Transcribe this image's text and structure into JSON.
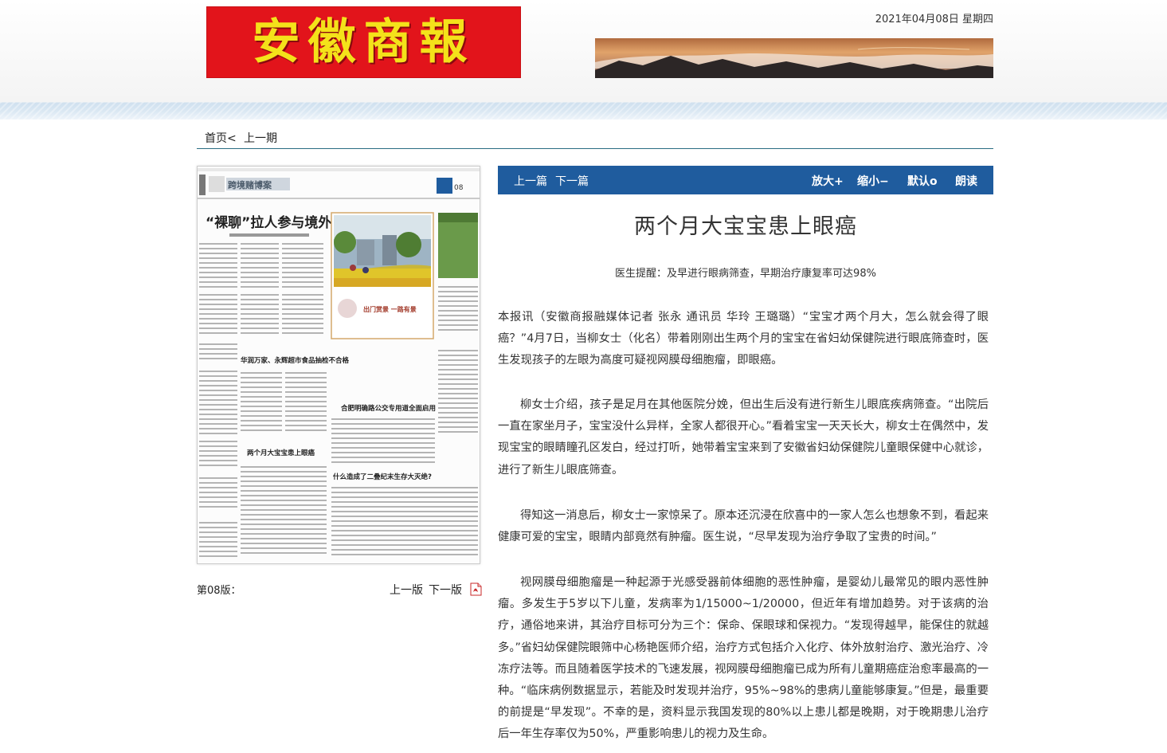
{
  "masthead": {
    "logo_text": "安徽商報",
    "date": "2021年04月08日 星期四"
  },
  "nav": {
    "home": "首页<",
    "prev_issue": "上一期"
  },
  "page_panel": {
    "edition_label": "第08版：",
    "prev_page": "上一版",
    "next_page": "下一版",
    "thumbnail": {
      "section_name": "跨境赌博案",
      "page_number": "08",
      "headlines": [
        "“裸聊”拉人参与境外网络赌博",
        "华润万家、永辉超市食品抽检不合格",
        "出门赏景 一路有景",
        "合肥明确路公交专用道全面启用",
        "两个月大宝宝患上眼癌",
        "什么造成了二叠纪末生存大灭绝?"
      ]
    }
  },
  "toolbar": {
    "prev_article": "上一篇",
    "next_article": "下一篇",
    "zoom_in": "放大+",
    "zoom_out": "缩小−",
    "default": "默认o",
    "read_aloud": "朗读"
  },
  "article": {
    "title": "两个月大宝宝患上眼癌",
    "subtitle": "医生提醒：及早进行眼病筛查，早期治疗康复率可达98%",
    "paragraphs": [
      "本报讯（安徽商报融媒体记者 张永 通讯员 华玲 王璐璐）“宝宝才两个月大，怎么就会得了眼癌？”4月7日，当柳女士（化名）带着刚刚出生两个月的宝宝在省妇幼保健院进行眼底筛查时，医生发现孩子的左眼为高度可疑视网膜母细胞瘤，即眼癌。",
      "柳女士介绍，孩子是足月在其他医院分娩，但出生后没有进行新生儿眼底疾病筛查。“出院后一直在家坐月子，宝宝没什么异样，全家人都很开心。”看着宝宝一天天长大，柳女士在偶然中，发现宝宝的眼睛瞳孔区发白，经过打听，她带着宝宝来到了安徽省妇幼保健院儿童眼保健中心就诊，进行了新生儿眼底筛查。",
      "得知这一消息后，柳女士一家惊呆了。原本还沉浸在欣喜中的一家人怎么也想象不到，看起来健康可爱的宝宝，眼睛内部竟然有肿瘤。医生说，“尽早发现为治疗争取了宝贵的时间。”",
      "视网膜母细胞瘤是一种起源于光感受器前体细胞的恶性肿瘤，是婴幼儿最常见的眼内恶性肿瘤。多发生于5岁以下儿童，发病率为1/15000~1/20000，但近年有增加趋势。对于该病的治疗，通俗地来讲，其治疗目标可分为三个：保命、保眼球和保视力。“发现得越早，能保住的就越多。”省妇幼保健院眼筛中心杨艳医师介绍，治疗方式包括介入化疗、体外放射治疗、激光治疗、冷冻疗法等。而且随着医学技术的飞速发展，视网膜母细胞瘤已成为所有儿童期癌症治愈率最高的一种。“临床病例数据显示，若能及时发现并治疗，95%~98%的患病儿童能够康复。”但是，最重要的前提是“早发现”。不幸的是，资料显示我国发现的80%以上患儿都是晚期，对于晚期患儿治疗后一年生存率仅为50%，严重影响患儿的视力及生命。"
    ]
  },
  "colors": {
    "toolbar_blue": "#1f5c9e",
    "logo_red": "#e2141b",
    "logo_yellow": "#f4e21a",
    "nav_rule": "#2b6d83"
  }
}
